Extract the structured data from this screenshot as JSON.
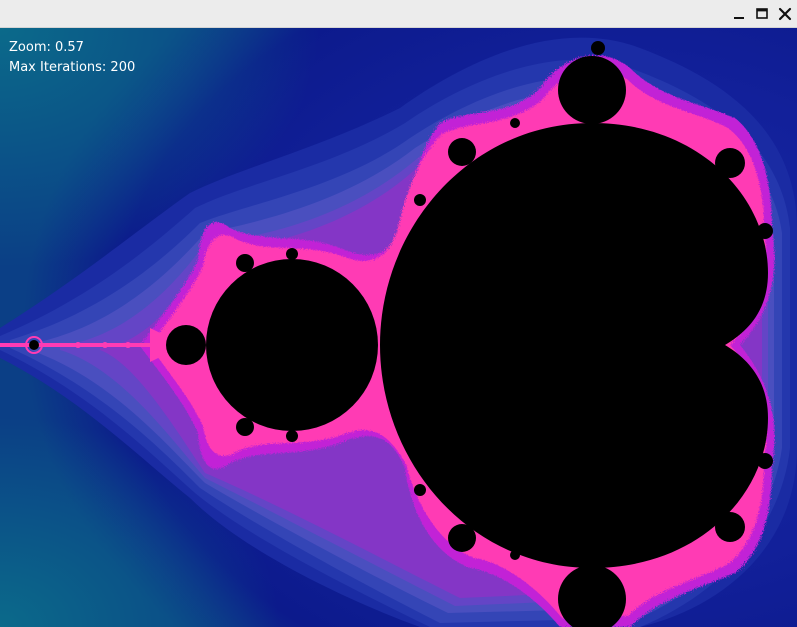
{
  "window": {
    "controls": {
      "minimize_icon": "minimize-icon",
      "maximize_icon": "maximize-icon",
      "close_icon": "close-icon"
    }
  },
  "overlay": {
    "zoom_text": "Zoom: 0.57",
    "iterations_text": "Max Iterations: 200"
  },
  "fractal": {
    "palette": {
      "background_outer": "#0a1f8f",
      "band_1": "#15289e",
      "band_2": "#2a3cb0",
      "band_3": "#4a52c0",
      "band_4": "#6b4fc9",
      "band_5": "#8b34c8",
      "edge_magenta": "#ff3fb8",
      "edge_violet": "#c31fd8",
      "set_interior": "#000000",
      "corner_teal": "#0b5d86"
    }
  }
}
